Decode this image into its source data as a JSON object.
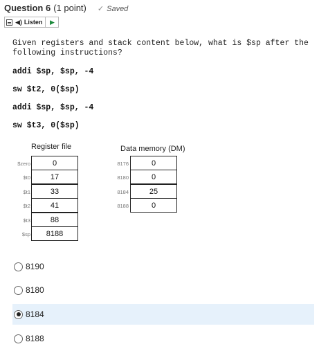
{
  "header": {
    "title": "Question 6",
    "points": "(1 point)",
    "saved": "Saved"
  },
  "toolbar": {
    "listen_label": "Listen"
  },
  "question": {
    "text": "Given registers and stack content below, what is $sp after the following instructions?",
    "instructions": [
      "addi $sp, $sp, -4",
      "sw $t2, 0($sp)",
      "addi $sp, $sp, -4",
      "sw $t3, 0($sp)"
    ]
  },
  "register_file": {
    "title": "Register file",
    "rows": [
      {
        "name": "$zero",
        "value": "0"
      },
      {
        "name": "$t0",
        "value": "17"
      },
      {
        "name": "$t1",
        "value": "33"
      },
      {
        "name": "$t2",
        "value": "41"
      },
      {
        "name": "$t3",
        "value": "88"
      },
      {
        "name": "$sp",
        "value": "8188"
      }
    ]
  },
  "data_memory": {
    "title": "Data memory (DM)",
    "rows": [
      {
        "address": "8176",
        "value": "0"
      },
      {
        "address": "8180",
        "value": "0"
      },
      {
        "address": "8184",
        "value": "25"
      },
      {
        "address": "8188",
        "value": "0"
      }
    ]
  },
  "options": [
    {
      "label": "8190",
      "selected": false
    },
    {
      "label": "8180",
      "selected": false
    },
    {
      "label": "8184",
      "selected": true
    },
    {
      "label": "8188",
      "selected": false
    }
  ]
}
